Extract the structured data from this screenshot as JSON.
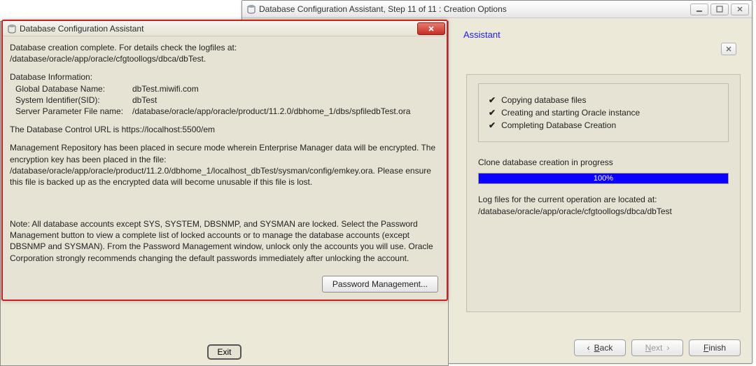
{
  "wizard": {
    "title": "Database Configuration Assistant, Step 11 of 11 : Creation Options",
    "subheader": "Assistant",
    "steps": {
      "s0": {
        "label": "Copying database files",
        "done": true
      },
      "s1": {
        "label": "Creating and starting Oracle instance",
        "done": true
      },
      "s2": {
        "label": "Completing Database Creation",
        "done": true
      }
    },
    "clone_label": "Clone database creation in progress",
    "progress_percent": 100,
    "progress_text": "100%",
    "log_line1": "Log files for the current operation are located at:",
    "log_line2": "/database/oracle/app/oracle/cfgtoollogs/dbca/dbTest",
    "footer": {
      "back": "Back",
      "next": "Next",
      "finish": "Finish"
    }
  },
  "shell": {
    "exit": "Exit"
  },
  "dialog": {
    "title": "Database Configuration Assistant",
    "intro_l1": "Database creation complete. For details check the logfiles at:",
    "intro_l2": " /database/oracle/app/oracle/cfgtoollogs/dbca/dbTest.",
    "info_header": "Database Information:",
    "rows": {
      "r0": {
        "label": "Global Database Name:",
        "value": "dbTest.miwifi.com"
      },
      "r1": {
        "label": "System Identifier(SID):",
        "value": "dbTest"
      },
      "r2": {
        "label": "Server Parameter File name:",
        "value": "/database/oracle/app/oracle/product/11.2.0/dbhome_1/dbs/spfiledbTest.ora"
      }
    },
    "url_line": "The Database Control URL is https://localhost:5500/em",
    "mgmt_text": "Management Repository has been placed in secure mode wherein Enterprise Manager data will be encrypted. The encryption key has been placed in the file: /database/oracle/app/oracle/product/11.2.0/dbhome_1/localhost_dbTest/sysman/config/emkey.ora.   Please ensure this file is backed up as the encrypted data will become unusable if this file is lost.",
    "note_text": "Note: All database accounts except SYS, SYSTEM, DBSNMP, and SYSMAN are locked. Select the Password Management button to view a complete list of locked accounts or to manage the database accounts (except DBSNMP and SYSMAN). From the Password Management window, unlock only the accounts you will use. Oracle Corporation strongly recommends changing the default passwords immediately after unlocking the account.",
    "pm_button": "Password Management..."
  }
}
